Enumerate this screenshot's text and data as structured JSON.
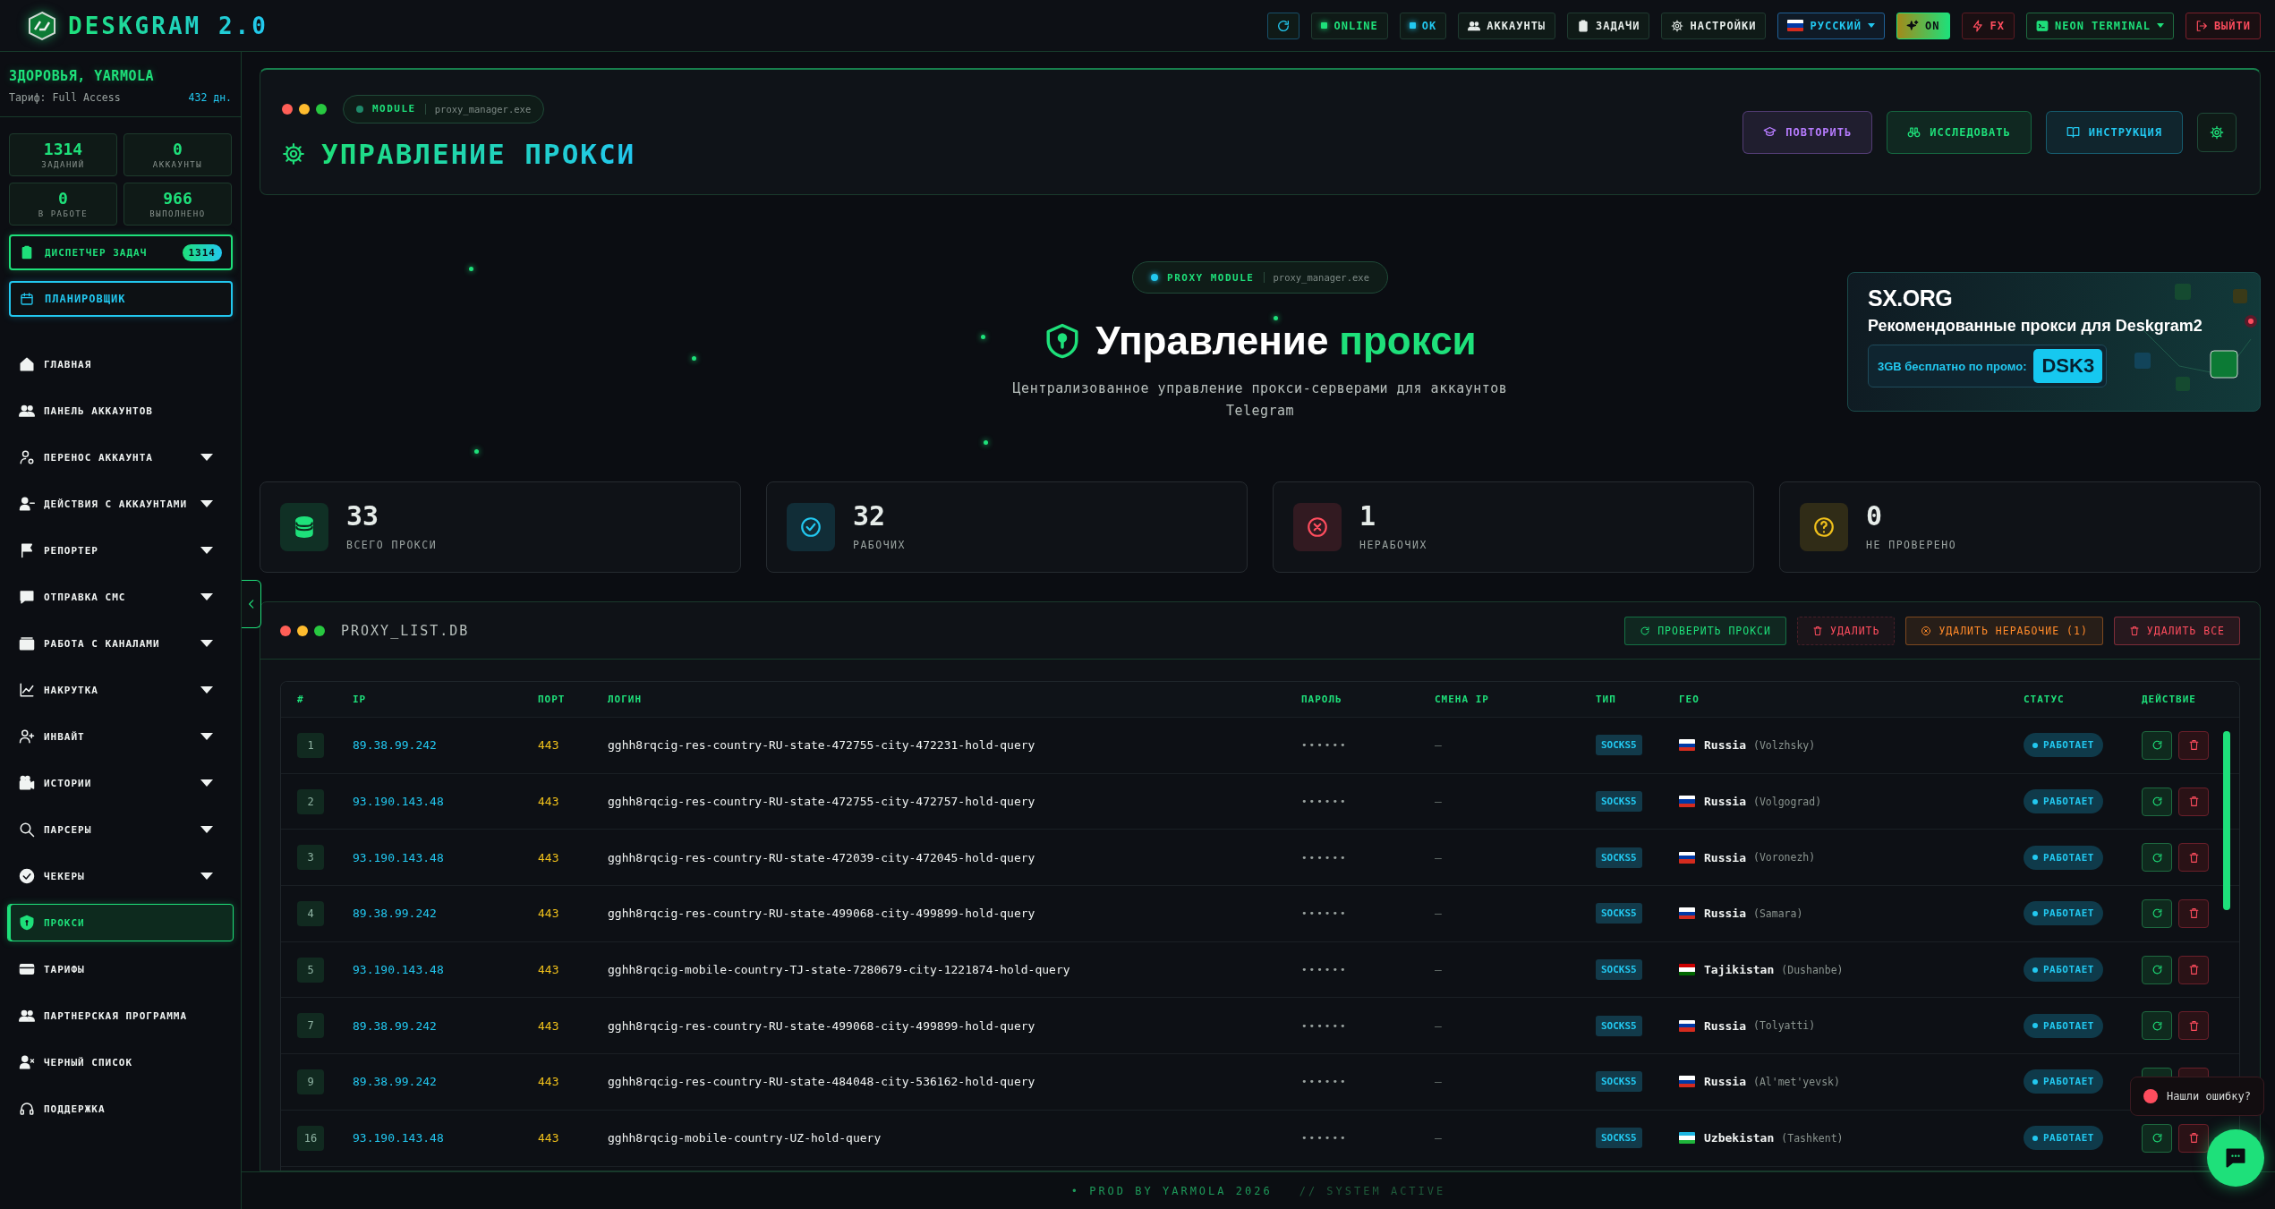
{
  "brand": {
    "name": "DESKGRAM 2.0"
  },
  "topbar": {
    "items": [
      {
        "kind": "status",
        "label": "ONLINE",
        "color": "#1ee07a"
      },
      {
        "kind": "status",
        "label": "OK",
        "color": "#22c8f0"
      },
      {
        "kind": "nav",
        "label": "АККАУНТЫ"
      },
      {
        "kind": "nav",
        "label": "ЗАДАЧИ"
      },
      {
        "kind": "nav",
        "label": "НАСТРОЙКИ"
      },
      {
        "kind": "language",
        "label": "РУССКИЙ"
      },
      {
        "kind": "toggle",
        "label": "ON",
        "on": true
      },
      {
        "kind": "fx",
        "label": "FX"
      },
      {
        "kind": "theme",
        "label": "NEON TERMINAL"
      },
      {
        "kind": "logout",
        "label": "ВЫЙТИ"
      }
    ]
  },
  "sidebar": {
    "greeting": "ЗДОРОВЬЯ, YARMOLA",
    "plan": "Тариф: Full Access",
    "days": "432 дн.",
    "stats": [
      {
        "value": "1314",
        "label": "ЗАДАНИЙ"
      },
      {
        "value": "0",
        "label": "АККАУНТЫ"
      },
      {
        "value": "0",
        "label": "В РАБОТЕ"
      },
      {
        "value": "966",
        "label": "ВЫПОЛНЕНО"
      }
    ],
    "dispatcher": {
      "label": "ДИСПЕТЧЕР ЗАДАЧ",
      "badge": "1314"
    },
    "planner": {
      "label": "ПЛАНИРОВЩИК"
    },
    "nav": [
      {
        "label": "ГЛАВНАЯ",
        "expandable": false,
        "selected": false
      },
      {
        "label": "ПАНЕЛЬ АККАУНТОВ",
        "expandable": false,
        "selected": false
      },
      {
        "label": "ПЕРЕНОС АККАУНТА",
        "expandable": true,
        "selected": false
      },
      {
        "label": "ДЕЙСТВИЯ С АККАУНТАМИ",
        "expandable": true,
        "selected": false
      },
      {
        "label": "РЕПОРТЕР",
        "expandable": true,
        "selected": false
      },
      {
        "label": "ОТПРАВКА СМС",
        "expandable": true,
        "selected": false
      },
      {
        "label": "РАБОТА С КАНАЛАМИ",
        "expandable": true,
        "selected": false
      },
      {
        "label": "НАКРУТКА",
        "expandable": true,
        "selected": false
      },
      {
        "label": "ИНВАЙТ",
        "expandable": true,
        "selected": false
      },
      {
        "label": "ИСТОРИИ",
        "expandable": true,
        "selected": false
      },
      {
        "label": "ПАРСЕРЫ",
        "expandable": true,
        "selected": false
      },
      {
        "label": "ЧЕКЕРЫ",
        "expandable": true,
        "selected": false
      },
      {
        "label": "ПРОКСИ",
        "expandable": false,
        "selected": true
      },
      {
        "label": "ТАРИФЫ",
        "expandable": false,
        "selected": false
      },
      {
        "label": "ПАРТНЕРСКАЯ ПРОГРАММА",
        "expandable": false,
        "selected": false
      },
      {
        "label": "ЧЕРНЫЙ СПИСОК",
        "expandable": false,
        "selected": false
      },
      {
        "label": "ПОДДЕРЖКА",
        "expandable": false,
        "selected": false
      }
    ]
  },
  "header": {
    "module_label": "MODULE",
    "module_file": "proxy_manager.exe",
    "title": "УПРАВЛЕНИЕ ПРОКСИ",
    "buttons": [
      {
        "label": "ПОВТОРИТЬ",
        "color": "#b77cff"
      },
      {
        "label": "ИССЛЕДОВАТЬ",
        "color": "#1ee07a"
      },
      {
        "label": "ИНСТРУКЦИЯ",
        "color": "#22c8f0"
      }
    ]
  },
  "hero": {
    "module_label": "PROXY MODULE",
    "module_file": "proxy_manager.exe",
    "title": "Управление",
    "title_accent": "прокси",
    "subtitle": "Централизованное управление прокси-серверами для аккаунтов Telegram"
  },
  "promo": {
    "logo": "SX.ORG",
    "headline": "Рекомендованные прокси для Deskgram2",
    "offer": "3GB бесплатно по промо:",
    "code": "DSK3"
  },
  "stats": [
    {
      "value": "33",
      "label": "ВСЕГО ПРОКСИ",
      "color": "#1ee07a"
    },
    {
      "value": "32",
      "label": "РАБОЧИХ",
      "color": "#22c8f0"
    },
    {
      "value": "1",
      "label": "НЕРАБОЧИХ",
      "color": "#ff4d5e"
    },
    {
      "value": "0",
      "label": "НЕ ПРОВЕРЕНО",
      "color": "#f2c21b"
    }
  ],
  "table": {
    "title": "PROXY_LIST.DB",
    "actions": [
      {
        "label": "ПРОВЕРИТЬ ПРОКСИ",
        "color": "#1ee07a",
        "disabled": false
      },
      {
        "label": "УДАЛИТЬ",
        "color": "#ff4d5e",
        "disabled": true
      },
      {
        "label": "УДАЛИТЬ НЕРАБОЧИЕ (1)",
        "color": "#ff8a2a",
        "disabled": false
      },
      {
        "label": "УДАЛИТЬ ВСЕ",
        "color": "#ff4d5e",
        "disabled": false
      }
    ],
    "columns": [
      "#",
      "IP",
      "ПОРТ",
      "ЛОГИН",
      "ПАРОЛЬ",
      "СМЕНА IP",
      "ТИП",
      "ГЕО",
      "СТАТУС",
      "ДЕЙСТВИЕ"
    ],
    "rows": [
      {
        "num": "1",
        "ip": "89.38.99.242",
        "port": "443",
        "login": "gghh8rqcig-res-country-RU-state-472755-city-472231-hold-query",
        "password": "••••••",
        "ip_change": "—",
        "type": "SOCKS5",
        "country": "Russia",
        "city": "(Volzhsky)",
        "flag": [
          {
            "color": "#ffffff"
          },
          {
            "color": "#0039a6"
          },
          {
            "color": "#d52b1e"
          }
        ],
        "status": "РАБОТАЕТ"
      },
      {
        "num": "2",
        "ip": "93.190.143.48",
        "port": "443",
        "login": "gghh8rqcig-res-country-RU-state-472755-city-472757-hold-query",
        "password": "••••••",
        "ip_change": "—",
        "type": "SOCKS5",
        "country": "Russia",
        "city": "(Volgograd)",
        "flag": [
          {
            "color": "#ffffff"
          },
          {
            "color": "#0039a6"
          },
          {
            "color": "#d52b1e"
          }
        ],
        "status": "РАБОТАЕТ"
      },
      {
        "num": "3",
        "ip": "93.190.143.48",
        "port": "443",
        "login": "gghh8rqcig-res-country-RU-state-472039-city-472045-hold-query",
        "password": "••••••",
        "ip_change": "—",
        "type": "SOCKS5",
        "country": "Russia",
        "city": "(Voronezh)",
        "flag": [
          {
            "color": "#ffffff"
          },
          {
            "color": "#0039a6"
          },
          {
            "color": "#d52b1e"
          }
        ],
        "status": "РАБОТАЕТ"
      },
      {
        "num": "4",
        "ip": "89.38.99.242",
        "port": "443",
        "login": "gghh8rqcig-res-country-RU-state-499068-city-499899-hold-query",
        "password": "••••••",
        "ip_change": "—",
        "type": "SOCKS5",
        "country": "Russia",
        "city": "(Samara)",
        "flag": [
          {
            "color": "#ffffff"
          },
          {
            "color": "#0039a6"
          },
          {
            "color": "#d52b1e"
          }
        ],
        "status": "РАБОТАЕТ"
      },
      {
        "num": "5",
        "ip": "93.190.143.48",
        "port": "443",
        "login": "gghh8rqcig-mobile-country-TJ-state-7280679-city-1221874-hold-query",
        "password": "••••••",
        "ip_change": "—",
        "type": "SOCKS5",
        "country": "Tajikistan",
        "city": "(Dushanbe)",
        "flag": [
          {
            "color": "#cc0000"
          },
          {
            "color": "#ffffff"
          },
          {
            "color": "#006600"
          }
        ],
        "status": "РАБОТАЕТ"
      },
      {
        "num": "7",
        "ip": "89.38.99.242",
        "port": "443",
        "login": "gghh8rqcig-res-country-RU-state-499068-city-499899-hold-query",
        "password": "••••••",
        "ip_change": "—",
        "type": "SOCKS5",
        "country": "Russia",
        "city": "(Tolyatti)",
        "flag": [
          {
            "color": "#ffffff"
          },
          {
            "color": "#0039a6"
          },
          {
            "color": "#d52b1e"
          }
        ],
        "status": "РАБОТАЕТ"
      },
      {
        "num": "9",
        "ip": "89.38.99.242",
        "port": "443",
        "login": "gghh8rqcig-res-country-RU-state-484048-city-536162-hold-query",
        "password": "••••••",
        "ip_change": "—",
        "type": "SOCKS5",
        "country": "Russia",
        "city": "(Al'met'yevsk)",
        "flag": [
          {
            "color": "#ffffff"
          },
          {
            "color": "#0039a6"
          },
          {
            "color": "#d52b1e"
          }
        ],
        "status": "РАБОТАЕТ"
      },
      {
        "num": "16",
        "ip": "93.190.143.48",
        "port": "443",
        "login": "gghh8rqcig-mobile-country-UZ-hold-query",
        "password": "••••••",
        "ip_change": "—",
        "type": "SOCKS5",
        "country": "Uzbekistan",
        "city": "(Tashkent)",
        "flag": [
          {
            "color": "#1eb5e0"
          },
          {
            "color": "#ffffff"
          },
          {
            "color": "#1eb53a"
          }
        ],
        "status": "РАБОТАЕТ"
      }
    ]
  },
  "footer": {
    "credit": "• PROD BY YARMOLA 2026",
    "system": "// SYSTEM ACTIVE"
  },
  "feedback": {
    "label": "Нашли ошибку?"
  }
}
